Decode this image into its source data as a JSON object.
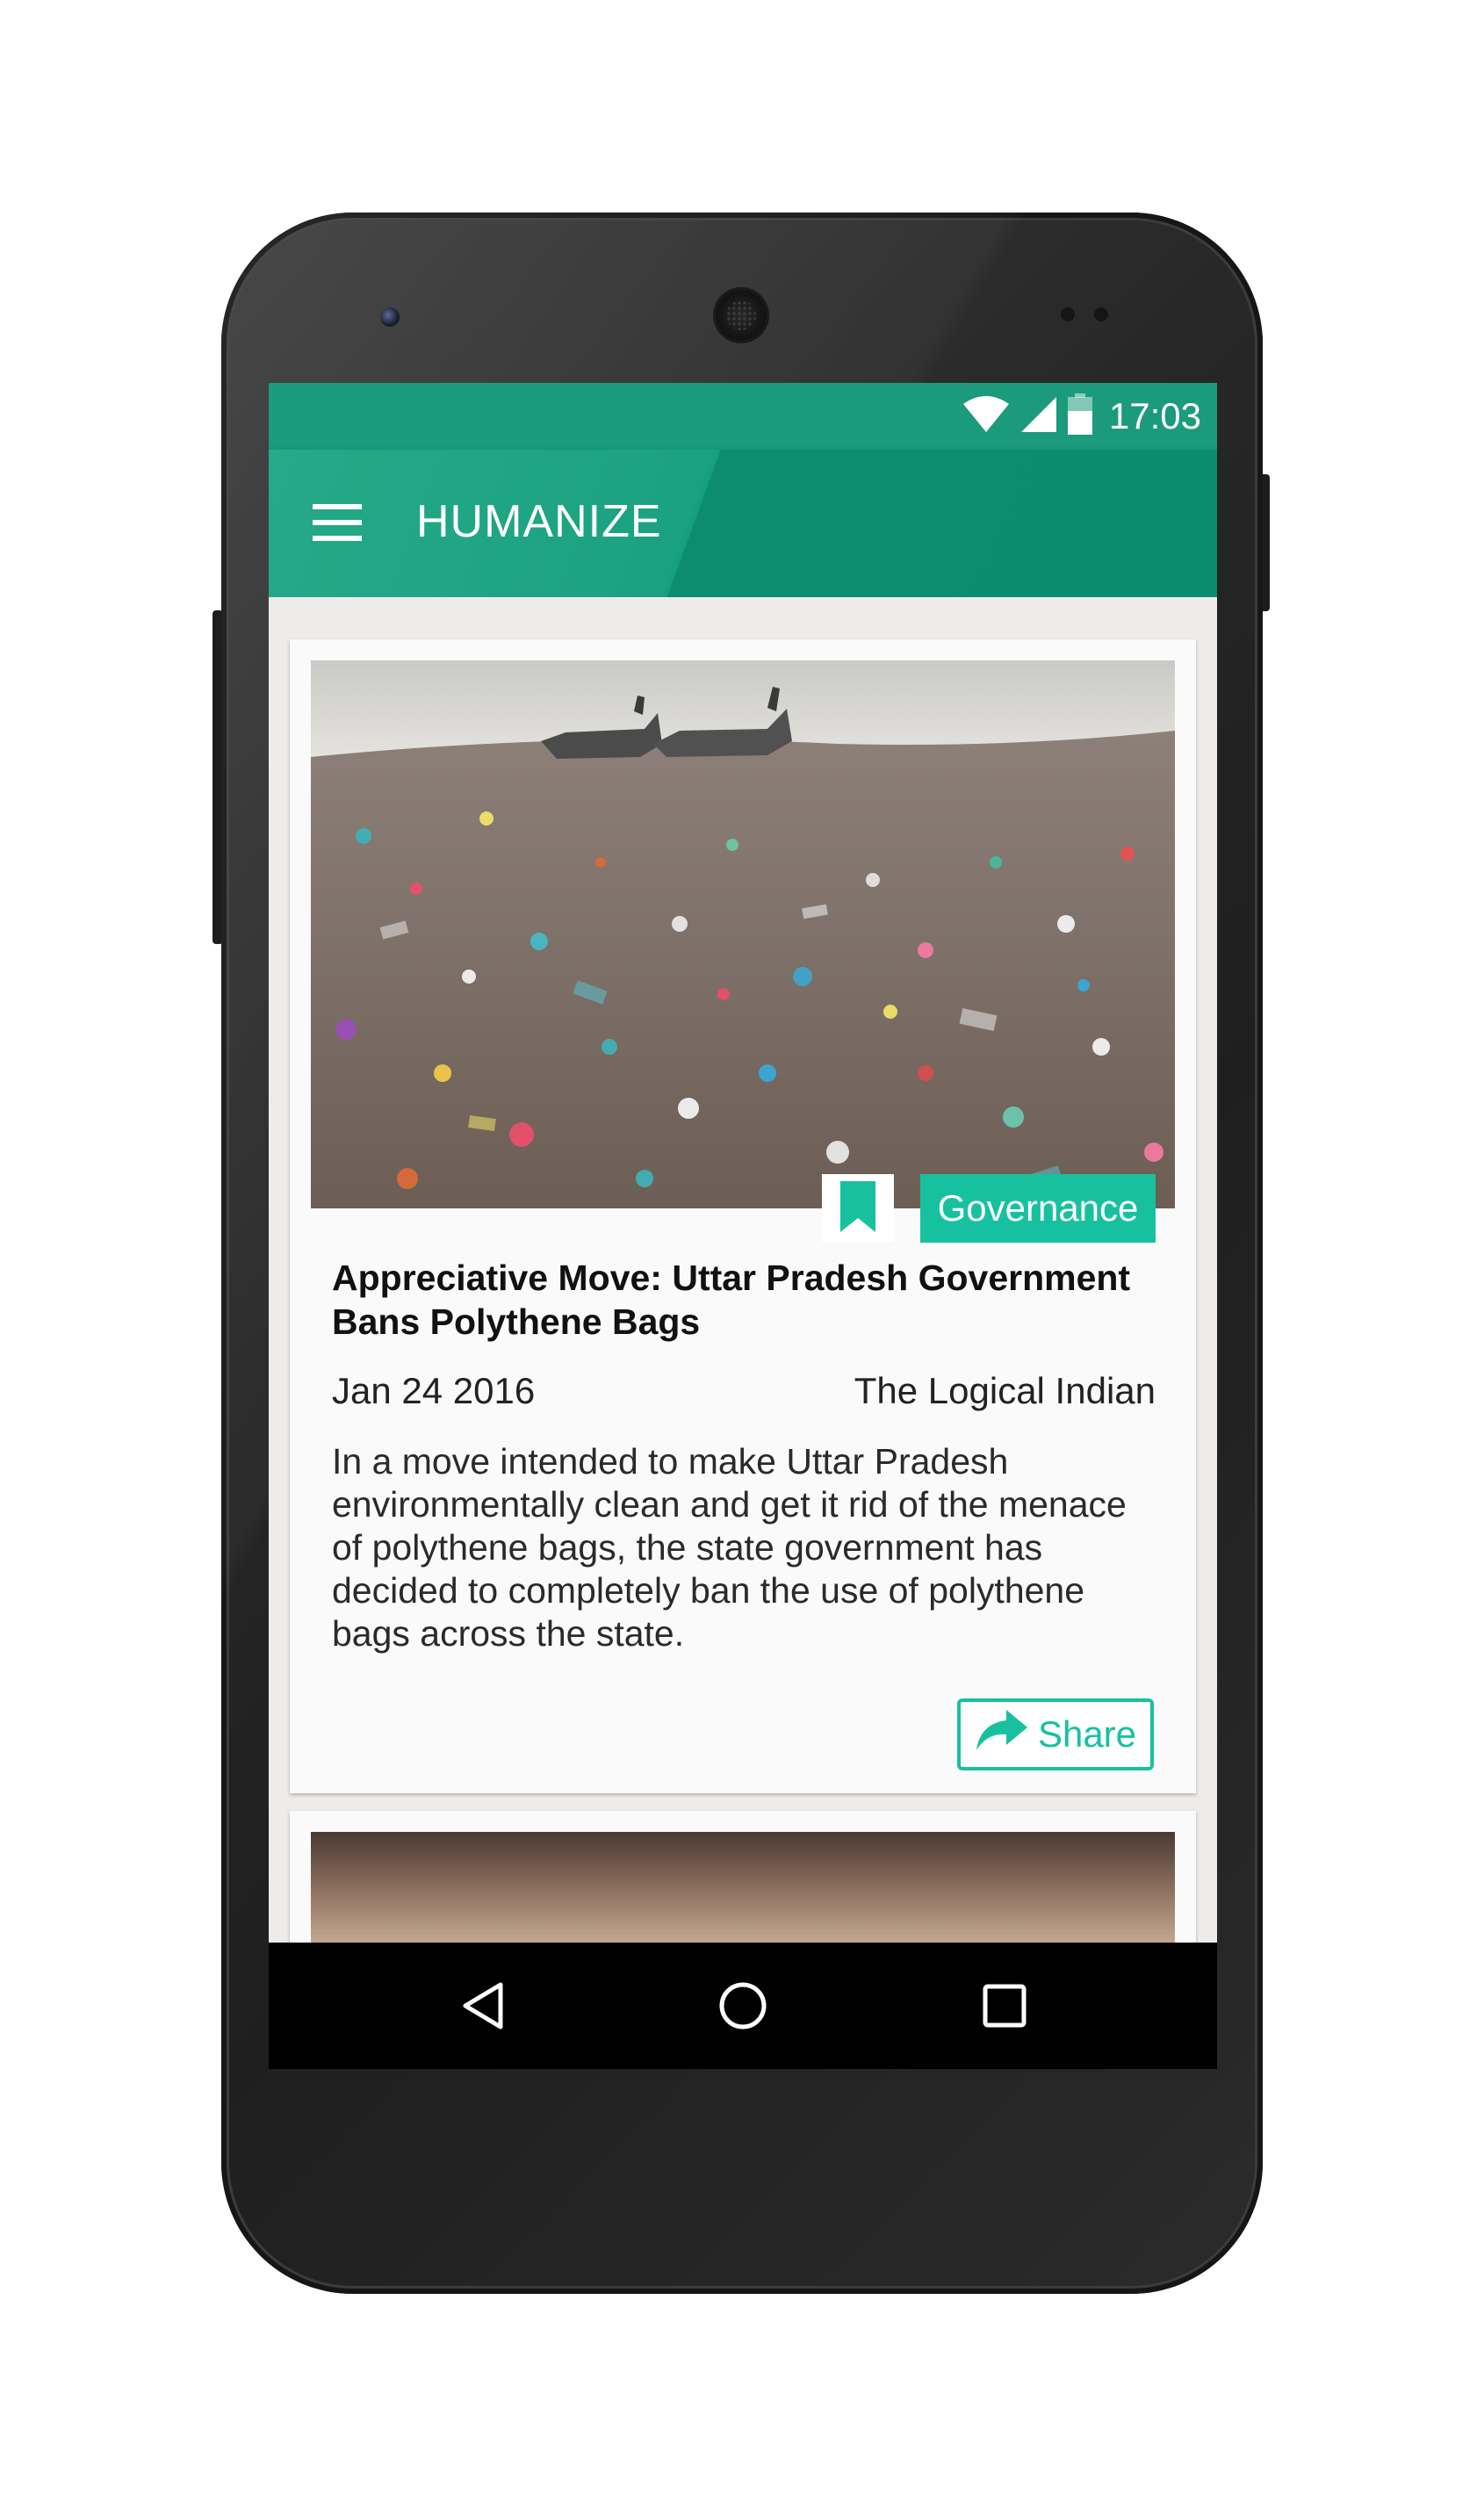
{
  "device": {
    "front_camera_icon": "front-camera-icon",
    "earpiece_icon": "speaker-grille-icon"
  },
  "status_bar": {
    "time": "17:03",
    "wifi_icon": "wifi-icon",
    "signal_icon": "cell-signal-icon",
    "battery_icon": "battery-icon",
    "color": "#1b9b7b"
  },
  "app_bar": {
    "title": "HUMANIZE",
    "menu_icon": "hamburger-menu-icon",
    "color": "#0a8c6d"
  },
  "feed": {
    "cards": [
      {
        "category": "Governance",
        "title": "Appreciative Move: Uttar Pradesh Government Bans Polythene Bags",
        "date": "Jan 24 2016",
        "source": "The Logical Indian",
        "summary": "In a move intended to make Uttar Pradesh environmentally clean and get it rid of the menace of polythene bags, the state government has decided to completely ban the use of polythene bags across the state.",
        "share_label": "Share",
        "share_icon": "share-arrow-icon",
        "bookmark_icon": "bookmark-icon",
        "image_icon": "landfill-with-boats-photo"
      }
    ],
    "accent_color": "#17c1a0"
  },
  "nav_bar": {
    "back_icon": "back-triangle-icon",
    "home_icon": "home-circle-icon",
    "recents_icon": "recents-square-icon"
  }
}
